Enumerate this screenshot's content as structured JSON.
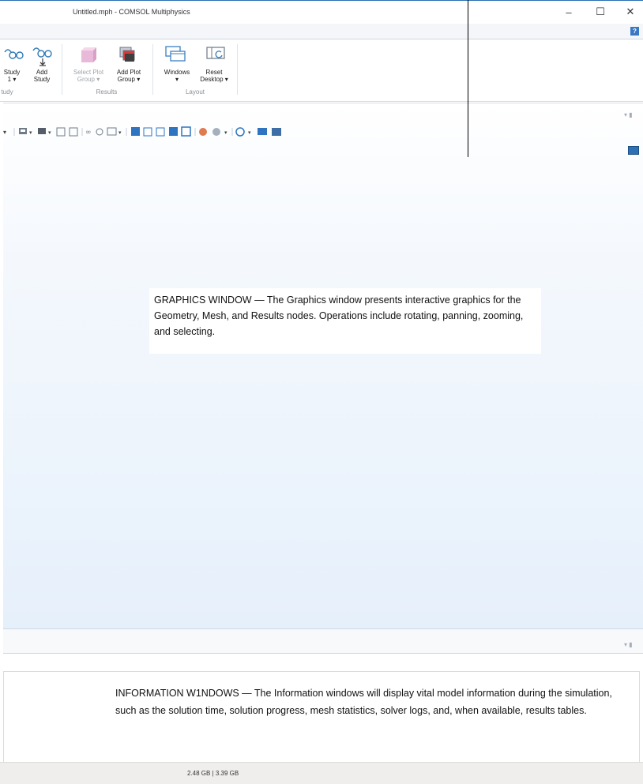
{
  "window": {
    "title": "Untitled.mph - COMSOL Multiphysics",
    "minimize": "–",
    "maximize": "☐",
    "close": "✕",
    "help": "?"
  },
  "ribbon": {
    "study_group_label": "tudy",
    "study_button": {
      "line1": "Study",
      "line2": "1 ▾"
    },
    "add_study_button": {
      "line1": "Add",
      "line2": "Study"
    },
    "results_group_label": "Results",
    "select_plot_group": {
      "line1": "Select Plot",
      "line2": "Group ▾"
    },
    "add_plot_group": {
      "line1": "Add Plot",
      "line2": "Group ▾"
    },
    "layout_group_label": "Layout",
    "windows_button": {
      "line1": "Windows",
      "line2": "▾"
    },
    "reset_desktop": {
      "line1": "Reset",
      "line2": "Desktop ▾"
    }
  },
  "graphics": {
    "callout": "GRAPHICS WINDOW — The Graphics window presents interactive graphics for the Geometry, Mesh, and Results nodes. Operations include rotating, panning, zooming, and selecting.",
    "pin_glyph": "▾ ▮"
  },
  "information": {
    "callout": "INFORMATION W1NDOWS — The Information windows will display vital model information during the simulation, such as the solution time, solution progress, mesh statistics, solver logs, and, when available, results tables.",
    "pin_glyph": "▾ ▮"
  },
  "status": {
    "memory": "2.48 GB | 3.39 GB"
  },
  "colors": {
    "accent": "#2a6fb0",
    "graphics_bg_bottom": "#e6f0fb"
  }
}
